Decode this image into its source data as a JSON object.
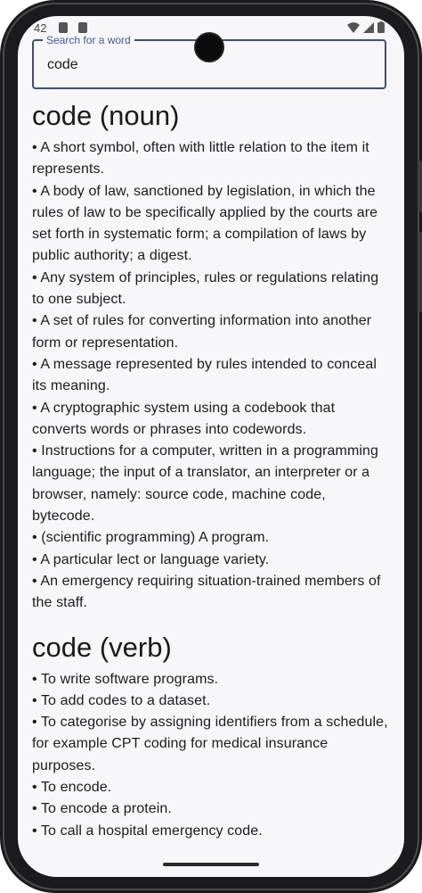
{
  "status_bar": {
    "time": "42",
    "icons": [
      "sim-card-icon",
      "accessibility-icon",
      "wifi-icon",
      "signal-icon",
      "battery-icon"
    ]
  },
  "search": {
    "label": "Search for a word",
    "value": "code"
  },
  "entries": [
    {
      "title": "code (noun)",
      "definitions": [
        "• A short symbol, often with little relation to the item it represents.",
        "• A body of law, sanctioned by legislation, in which the rules of law to be specifically applied by the courts are set forth in systematic form; a compilation of laws by public authority; a digest.",
        "• Any system of principles, rules or regulations relating to one subject.",
        "• A set of rules for converting information into another form or representation.",
        "• A message represented by rules intended to conceal its meaning.",
        "• A cryptographic system using a codebook that converts words or phrases into codewords.",
        "• Instructions for a computer, written in a programming language; the input of a translator, an interpreter or a browser, namely: source code, machine code, bytecode.",
        "• (scientific programming) A program.",
        "• A particular lect or language variety.",
        "• An emergency requiring situation-trained members of the staff."
      ]
    },
    {
      "title": "code (verb)",
      "definitions": [
        "• To write software programs.",
        "• To add codes to a dataset.",
        "• To categorise by assigning identifiers from a schedule, for example CPT coding for medical insurance purposes.",
        "• To encode.",
        "• To encode a protein.",
        "• To call a hospital emergency code."
      ]
    }
  ],
  "colors": {
    "accent": "#3d4f7a",
    "label": "#3d5a9a",
    "background": "#f7f7f9",
    "frame": "#1b1b1d"
  }
}
